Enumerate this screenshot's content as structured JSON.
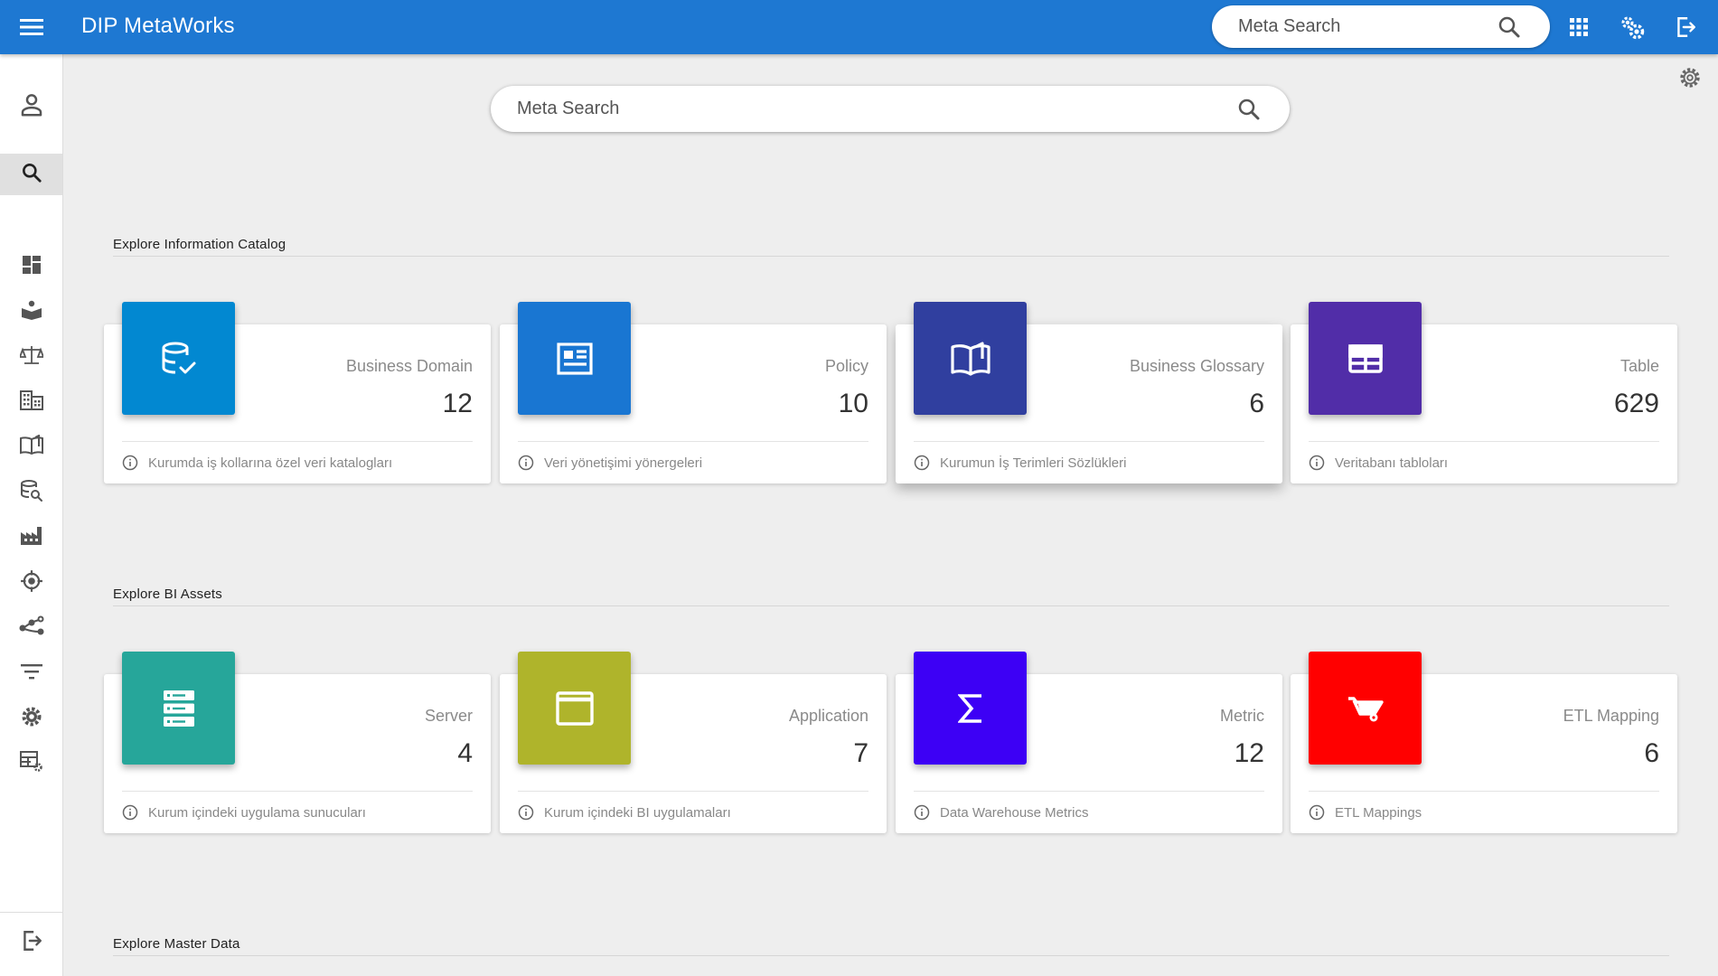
{
  "header": {
    "app_title": "DIP MetaWorks",
    "search_placeholder": "Meta Search",
    "color": "#1e78d2"
  },
  "main_search": {
    "placeholder": "Meta Search"
  },
  "sections": [
    {
      "title": "Explore Information Catalog",
      "cards": [
        {
          "label": "Business Domain",
          "count": "12",
          "description": "Kurumda iş kollarına özel veri katalogları",
          "icon": "database-check-icon",
          "color": "#0288d1"
        },
        {
          "label": "Policy",
          "count": "10",
          "description": "Veri yönetişimi yönergeleri",
          "icon": "newspaper-icon",
          "color": "#1976d2"
        },
        {
          "label": "Business Glossary",
          "count": "6",
          "description": "Kurumun İş Terimleri Sözlükleri",
          "icon": "open-book-icon",
          "color": "#303f9f"
        },
        {
          "label": "Table",
          "count": "629",
          "description": "Veritabanı tabloları",
          "icon": "table-icon",
          "color": "#512da8"
        }
      ]
    },
    {
      "title": "Explore BI Assets",
      "cards": [
        {
          "label": "Server",
          "count": "4",
          "description": "Kurum içindeki uygulama sunucuları",
          "icon": "server-icon",
          "color": "#26a69a"
        },
        {
          "label": "Application",
          "count": "7",
          "description": "Kurum içindeki BI uygulamaları",
          "icon": "window-icon",
          "color": "#afb42b"
        },
        {
          "label": "Metric",
          "count": "12",
          "description": "Data Warehouse Metrics",
          "icon": "sigma-icon",
          "color": "#3d00f5"
        },
        {
          "label": "ETL Mapping",
          "count": "6",
          "description": "ETL Mappings",
          "icon": "wheelbarrow-icon",
          "color": "#ff0000"
        }
      ]
    },
    {
      "title": "Explore Master Data",
      "cards": []
    }
  ],
  "sidebar": {
    "items": [
      {
        "icon": "user-icon"
      },
      {
        "icon": "search-icon",
        "active": true
      },
      {
        "icon": "dashboard-icon"
      },
      {
        "icon": "reader-icon"
      },
      {
        "icon": "scale-icon"
      },
      {
        "icon": "building-icon"
      },
      {
        "icon": "book-icon"
      },
      {
        "icon": "database-search-icon"
      },
      {
        "icon": "factory-icon"
      },
      {
        "icon": "crosshair-icon"
      },
      {
        "icon": "lineage-icon"
      },
      {
        "icon": "filter-icon"
      },
      {
        "icon": "gear-icon"
      },
      {
        "icon": "table-settings-icon"
      },
      {
        "icon": "logout-icon"
      }
    ]
  }
}
